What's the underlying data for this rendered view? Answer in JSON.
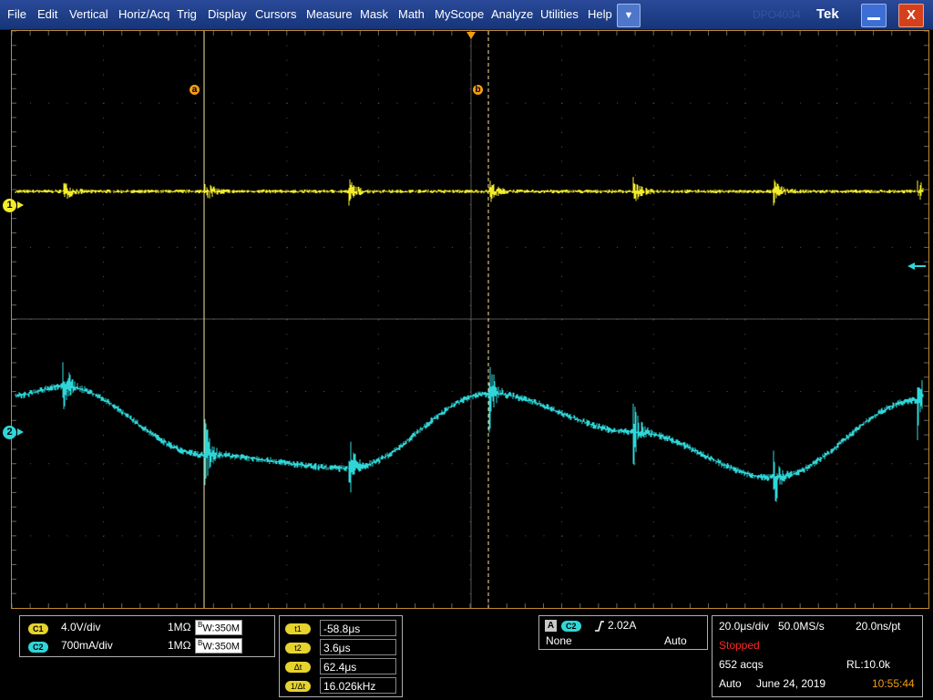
{
  "menu": {
    "items": [
      "File",
      "Edit",
      "Vertical",
      "Horiz/Acq",
      "Trig",
      "Display",
      "Cursors",
      "Measure",
      "Mask",
      "Math",
      "MyScope",
      "Analyze",
      "Utilities",
      "Help"
    ],
    "dropdown": "▼",
    "brand": "Tek",
    "ghost_text": "DPO4034",
    "close": "X"
  },
  "screen": {
    "ch1_marker": "1",
    "ch2_marker": "2",
    "cursor_a": "a",
    "cursor_b": "b"
  },
  "channels": {
    "c1": {
      "badge": "C1",
      "scale": "4.0V/div",
      "impedance": "1MΩ",
      "bw": "W:350M",
      "bw_prefix": "B"
    },
    "c2": {
      "badge": "C2",
      "scale": "700mA/div",
      "impedance": "1MΩ",
      "bw": "W:350M",
      "bw_prefix": "B"
    }
  },
  "cursors": {
    "t1": {
      "label": "t1",
      "value": "-58.8μs"
    },
    "t2": {
      "label": "t2",
      "value": "3.6μs"
    },
    "dt": {
      "label": "Δt",
      "value": "62.4μs"
    },
    "inv": {
      "label": "1/Δt",
      "value": "16.026kHz"
    }
  },
  "trigger": {
    "mode_badge": "A",
    "source": "C2",
    "level": "2.02A",
    "coupling": "None",
    "mode": "Auto"
  },
  "horizontal": {
    "time_div": "20.0μs/div",
    "sample_rate": "50.0MS/s",
    "per_pt": "20.0ns/pt",
    "status": "Stopped",
    "acqs": "652 acqs",
    "record_length": "RL:10.0k",
    "mode": "Auto",
    "date": "June 24, 2019",
    "time": "10:55:44"
  },
  "colors": {
    "ch1": "#f2ec2a",
    "ch2": "#2fd6d8",
    "accent": "#f39c18",
    "status_red": "#ff2a2a"
  }
}
